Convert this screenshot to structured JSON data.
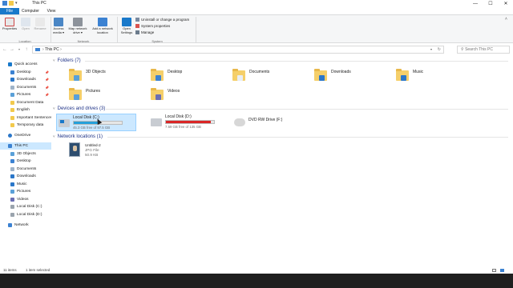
{
  "window": {
    "title": "This PC"
  },
  "window_controls": {
    "minimize": "—",
    "maximize": "☐",
    "close": "✕"
  },
  "ribbon_tabs": {
    "file": "File",
    "computer": "Computer",
    "view": "View"
  },
  "ribbon": {
    "location": {
      "label": "Location",
      "properties": "Properties",
      "open": "Open",
      "rename": "Rename"
    },
    "network": {
      "label": "Network",
      "access_media": "Access media ▾",
      "map_network_drive": "Map network drive ▾",
      "add_network_location": "Add a network location"
    },
    "system": {
      "label": "System",
      "open_settings": "Open Settings",
      "uninstall": "Uninstall or change a program",
      "system_properties": "System properties",
      "manage": "Manage"
    }
  },
  "address": {
    "path": "This PC",
    "search_placeholder": "Search This PC"
  },
  "nav": {
    "quick_access": "Quick access",
    "quick_items": [
      "Desktop",
      "Downloads",
      "Documents",
      "Pictures",
      "Document Data",
      "English",
      "Important Sentences",
      "Temporary data"
    ],
    "onedrive": "OneDrive",
    "this_pc": "This PC",
    "pc_items": [
      "3D Objects",
      "Desktop",
      "Documents",
      "Downloads",
      "Music",
      "Pictures",
      "Videos",
      "Local Disk (C:)",
      "Local Disk (D:)"
    ],
    "network": "Network",
    "pin_glyph": "📌"
  },
  "sections": {
    "folders": "Folders (7)",
    "devices": "Devices and drives (3)",
    "network": "Network locations (1)"
  },
  "folders": [
    "3D Objects",
    "Desktop",
    "Documents",
    "Downloads",
    "Music",
    "Pictures",
    "Videos"
  ],
  "drives": [
    {
      "name": "Local Disk (C:)",
      "free": "45.3 GB free of 97.5 GB",
      "used_fraction": 0.53,
      "bar_color": "#26a0da"
    },
    {
      "name": "Local Disk (D:)",
      "free": "7.59 GB free of 135 GB",
      "used_fraction": 0.94,
      "bar_color": "#da2626"
    },
    {
      "name": "DVD RW Drive (F:)",
      "free": "",
      "used_fraction": null,
      "bar_color": ""
    }
  ],
  "network_item": {
    "name": "Untitled-2",
    "type": "JPG File",
    "size": "50.9 KB"
  },
  "statusbar": {
    "items": "11 items",
    "selected": "1 item selected"
  },
  "colors": {
    "accent": "#1979ca",
    "selection": "#cce8ff",
    "section_header": "#1e3287"
  }
}
